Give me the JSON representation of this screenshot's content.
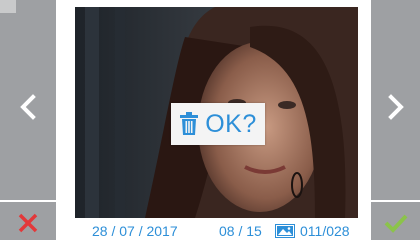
{
  "viewer": {
    "date": "28 / 07 / 2017",
    "count": "08 / 15",
    "index": "011/028"
  },
  "dialog": {
    "text": "OK?"
  },
  "icons": {
    "prev": "chevron-left-icon",
    "next": "chevron-right-icon",
    "cancel": "close-icon",
    "confirm": "check-icon",
    "delete": "trash-icon",
    "image": "image-icon"
  },
  "colors": {
    "accent": "#2d8fd8",
    "cancel": "#e3383a",
    "confirm": "#8bc34a",
    "panel": "#9ea0a3"
  }
}
